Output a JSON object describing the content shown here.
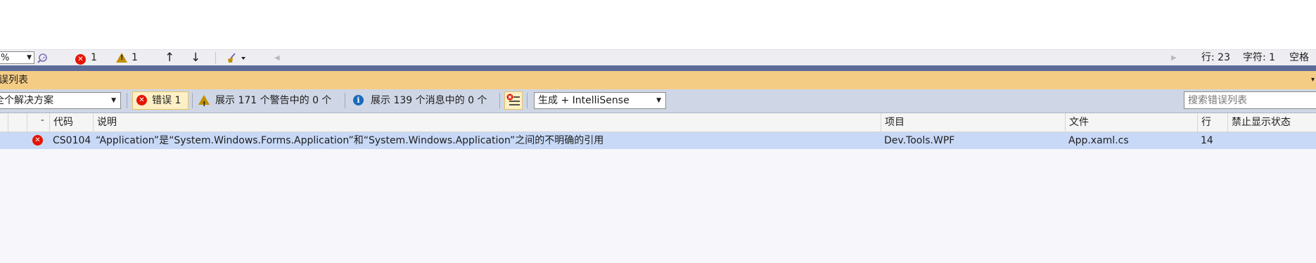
{
  "editor_bar": {
    "zoom": "%",
    "error_count": "1",
    "warning_count": "1",
    "line": "行: 23",
    "char": "字符: 1",
    "whitespace": "空格"
  },
  "panel": {
    "title": "误列表"
  },
  "toolbar": {
    "scope": "全个解决方案",
    "errors_label": "错误 1",
    "warnings_label": "展示 171 个警告中的 0 个",
    "messages_label": "展示 139 个消息中的 0 个",
    "build_filter": "生成 + IntelliSense",
    "search_placeholder": "搜索错误列表"
  },
  "table": {
    "columns": [
      "代码",
      "说明",
      "项目",
      "文件",
      "行",
      "禁止显示状态"
    ],
    "rows": [
      {
        "severity": "error",
        "code": "CS0104",
        "description": "“Application”是“System.Windows.Forms.Application”和“System.Windows.Application”之间的不明确的引用",
        "project": "Dev.Tools.WPF",
        "file": "App.xaml.cs",
        "line": "14",
        "suppression": ""
      }
    ]
  },
  "colors": {
    "title_bar": "#f5cc84",
    "toolbar": "#cfd6e5",
    "selected_row": "#c8d9f7",
    "error_red": "#e51400",
    "warning_yellow": "#c19000",
    "info_blue": "#1a6ab9"
  },
  "icons": [
    "dropdown-arrow-icon",
    "search-code-icon",
    "error-icon",
    "warning-icon",
    "arrow-up-icon",
    "arrow-down-icon",
    "broom-icon",
    "info-icon",
    "filter-errors-icon"
  ]
}
